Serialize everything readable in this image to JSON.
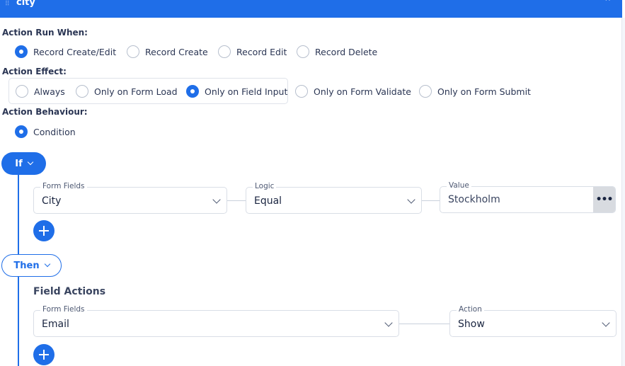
{
  "header": {
    "title": "city"
  },
  "run_when": {
    "label": "Action Run When:",
    "options": [
      "Record Create/Edit",
      "Record Create",
      "Record Edit",
      "Record Delete"
    ],
    "selected": "Record Create/Edit"
  },
  "effect": {
    "label": "Action Effect:",
    "options": [
      "Always",
      "Only on Form Load",
      "Only on Field Input",
      "Only on Form Validate",
      "Only on Form Submit"
    ],
    "selected": "Only on Field Input"
  },
  "behaviour": {
    "label": "Action Behaviour:",
    "options": [
      "Condition"
    ],
    "selected": "Condition"
  },
  "if_block": {
    "label": "If",
    "form_fields": {
      "label": "Form Fields",
      "value": "City"
    },
    "logic": {
      "label": "Logic",
      "value": "Equal"
    },
    "value": {
      "label": "Value",
      "value": "Stockholm"
    },
    "more_label": "•••"
  },
  "then_block": {
    "label": "Then",
    "section_title": "Field Actions",
    "form_fields": {
      "label": "Form Fields",
      "value": "Email"
    },
    "action": {
      "label": "Action",
      "value": "Show"
    }
  },
  "colors": {
    "accent": "#1f6ee8",
    "border": "#d9dee6",
    "text": "#1f2a44"
  }
}
